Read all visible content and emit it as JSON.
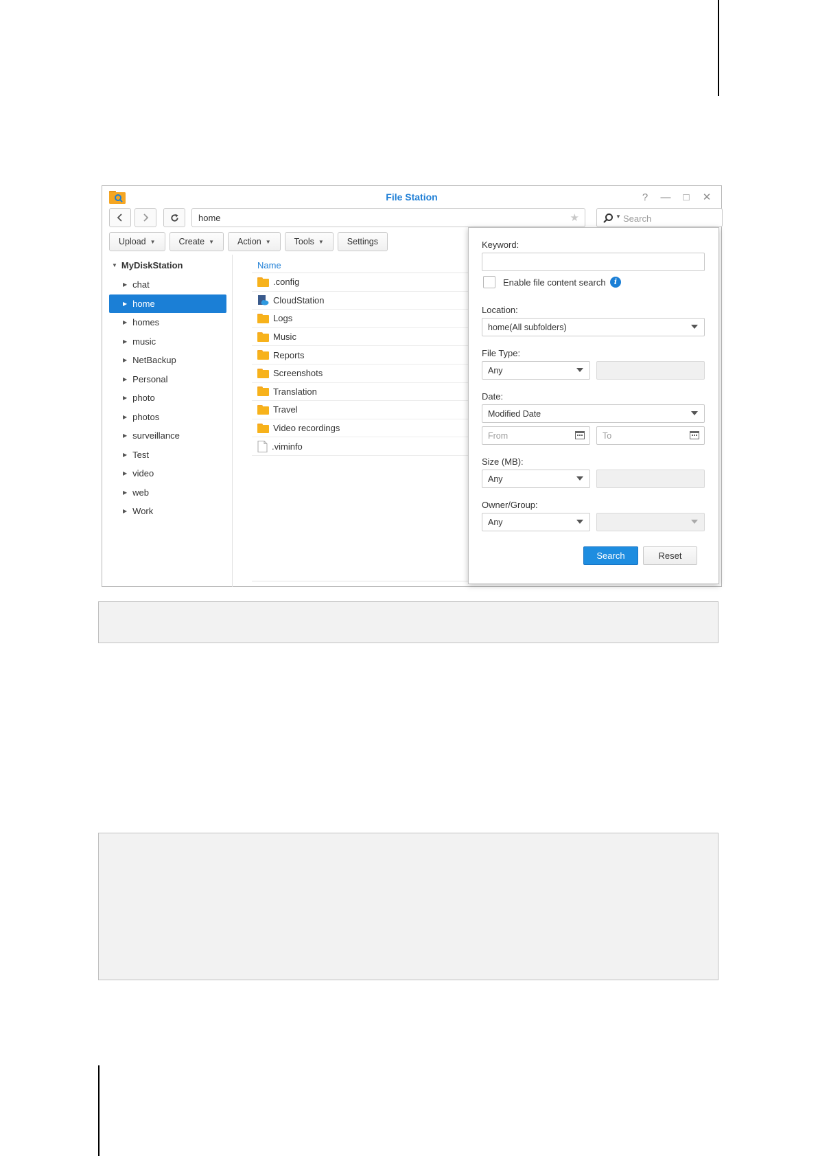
{
  "window": {
    "title": "File Station",
    "controls": {
      "help": "?",
      "minimize": "—",
      "maximize": "□",
      "close": "✕"
    }
  },
  "navbar": {
    "path": "home",
    "search_placeholder": "Search"
  },
  "toolbar": {
    "upload": "Upload",
    "create": "Create",
    "action": "Action",
    "tools": "Tools",
    "settings": "Settings"
  },
  "sidebar": {
    "root": "MyDiskStation",
    "items": [
      {
        "label": "chat"
      },
      {
        "label": "home",
        "selected": true
      },
      {
        "label": "homes"
      },
      {
        "label": "music"
      },
      {
        "label": "NetBackup"
      },
      {
        "label": "Personal"
      },
      {
        "label": "photo"
      },
      {
        "label": "photos"
      },
      {
        "label": "surveillance"
      },
      {
        "label": "Test"
      },
      {
        "label": "video"
      },
      {
        "label": "web"
      },
      {
        "label": "Work"
      }
    ]
  },
  "filelist": {
    "column_name": "Name",
    "rows": [
      {
        "name": ".config",
        "icon": "folder-icon"
      },
      {
        "name": "CloudStation",
        "icon": "cloudstation-folder-icon"
      },
      {
        "name": "Logs",
        "icon": "folder-icon"
      },
      {
        "name": "Music",
        "icon": "folder-icon"
      },
      {
        "name": "Reports",
        "icon": "folder-icon"
      },
      {
        "name": "Screenshots",
        "icon": "folder-icon"
      },
      {
        "name": "Translation",
        "icon": "folder-icon"
      },
      {
        "name": "Travel",
        "icon": "folder-icon"
      },
      {
        "name": "Video recordings",
        "icon": "folder-icon"
      },
      {
        "name": ".viminfo",
        "icon": "file-icon"
      }
    ]
  },
  "search_panel": {
    "keyword_label": "Keyword:",
    "keyword_value": "",
    "content_search_label": "Enable file content search",
    "location_label": "Location:",
    "location_value": "home(All subfolders)",
    "file_type_label": "File Type:",
    "file_type_value": "Any",
    "date_label": "Date:",
    "date_value": "Modified Date",
    "from_placeholder": "From",
    "to_placeholder": "To",
    "size_label": "Size (MB):",
    "size_value": "Any",
    "owner_label": "Owner/Group:",
    "owner_value": "Any",
    "search_button": "Search",
    "reset_button": "Reset"
  },
  "colors": {
    "accent": "#1b7fd6",
    "folder": "#f7b21b",
    "note_box": "#f2f2f2"
  }
}
